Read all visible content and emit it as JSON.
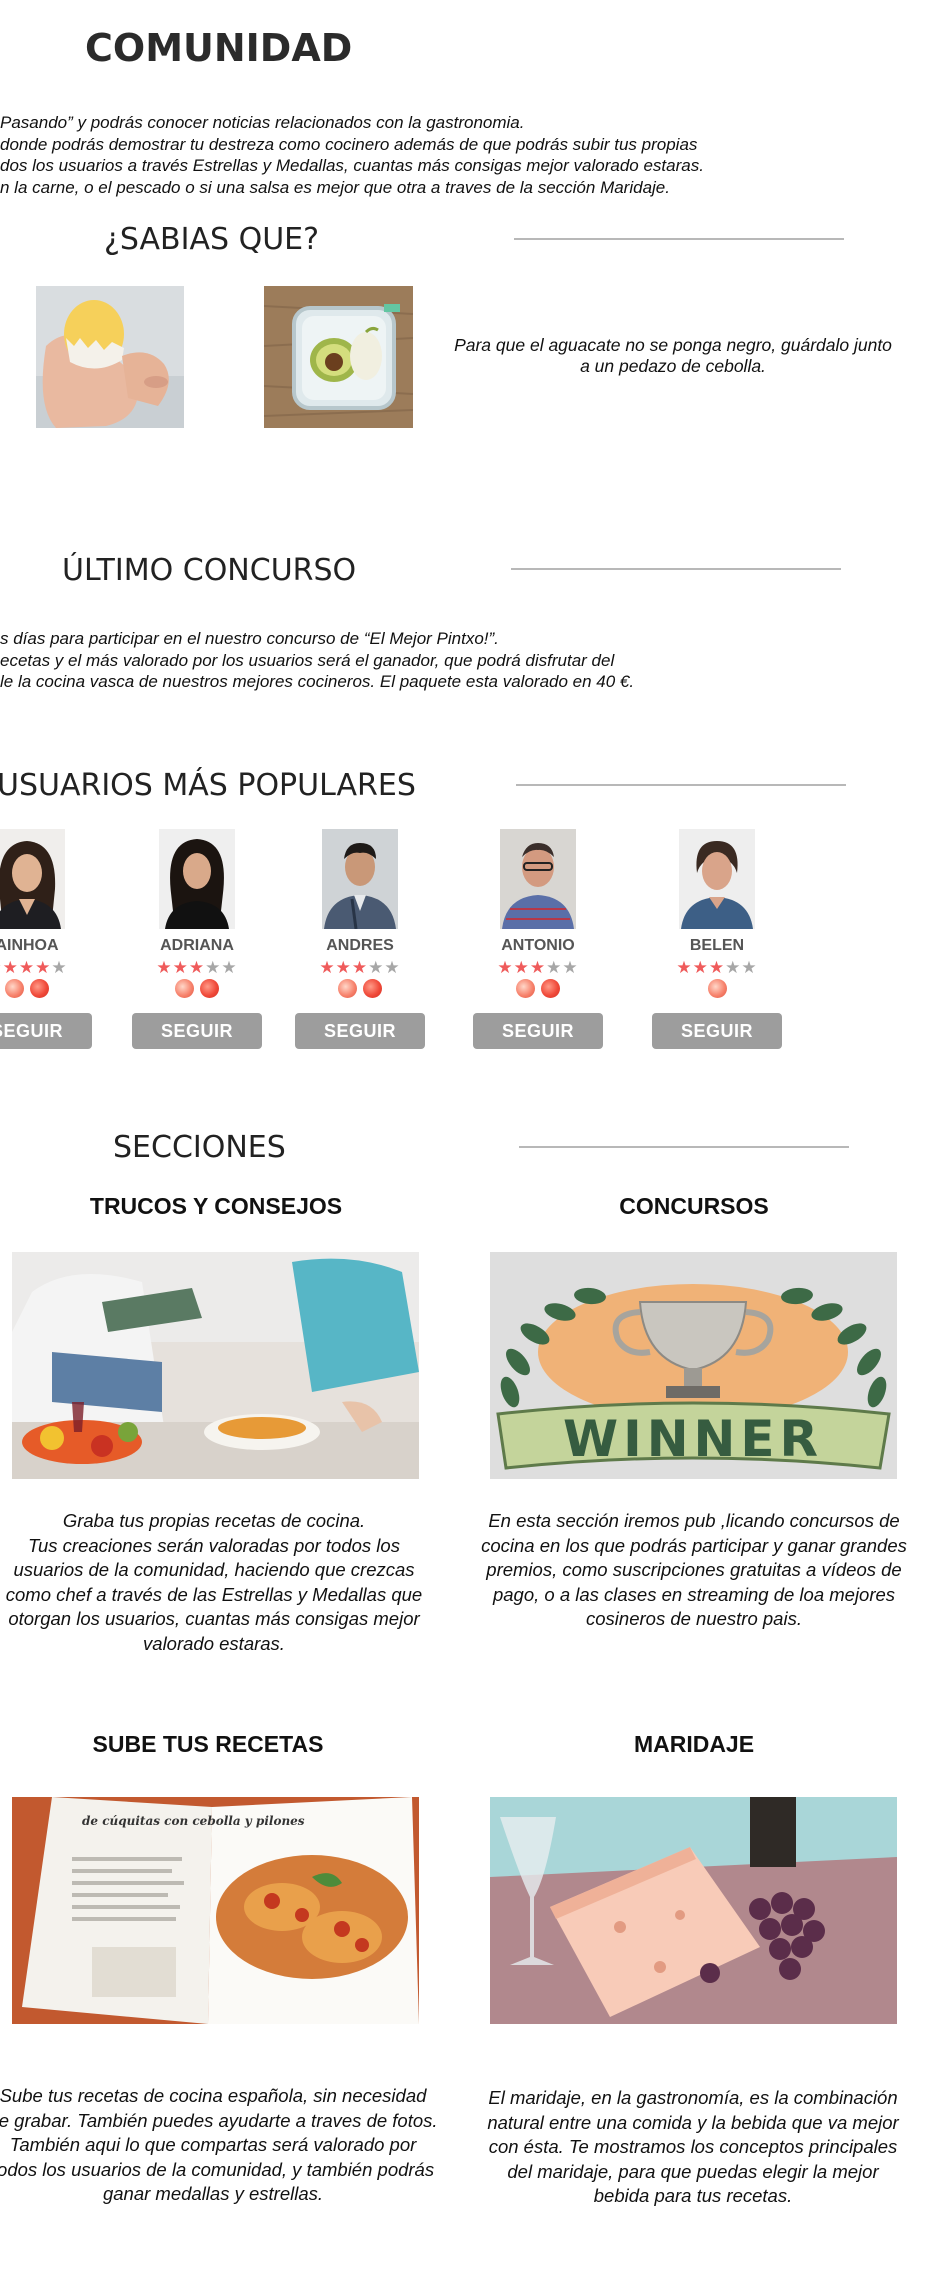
{
  "community": {
    "title": "COMUNIDAD",
    "lines": [
      "Pasando”  y podrás conocer noticias relacionados con la gastronomia.",
      "donde podrás demostrar tu destreza como cocinero además de que podrás subir tus propias",
      "dos los usuarios a través Estrellas y Medallas, cuantas más consigas mejor valorado estaras.",
      "n la carne, o el pescado o si una salsa es mejor que otra a traves de la sección Maridaje."
    ]
  },
  "tips": {
    "title": "¿SABIAS QUE?",
    "text": "Para que el aguacate no se ponga negro, guárdalo junto a un pedazo de cebolla."
  },
  "contest": {
    "title": "ÚLTIMO CONCURSO",
    "lines": [
      "s días para participar en el nuestro concurso de “El Mejor Pintxo!”.",
      "ecetas y el más valorado por los usuarios será el ganador, que podrá disfrutar del",
      "le la cocina vasca de nuestros mejores cocineros. El paquete esta valorado en 40 €."
    ]
  },
  "popular": {
    "title": "USUARIOS MÁS POPULARES",
    "users": [
      {
        "name": "AINHOA",
        "stars": 4,
        "medals": 2,
        "follow": "SEGUIR"
      },
      {
        "name": "ADRIANA",
        "stars": 3,
        "medals": 2,
        "follow": "SEGUIR"
      },
      {
        "name": "ANDRES",
        "stars": 3,
        "medals": 2,
        "follow": "SEGUIR"
      },
      {
        "name": "ANTONIO",
        "stars": 3,
        "medals": 2,
        "follow": "SEGUIR"
      },
      {
        "name": "BELEN",
        "stars": 3,
        "medals": 1,
        "follow": "SEGUIR"
      }
    ]
  },
  "sections": {
    "title": "SECCIONES",
    "tricks": {
      "title": "TRUCOS Y CONSEJOS",
      "text": "Graba tus propias recetas de cocina.\nTus creaciones serán valoradas por todos los usuarios de la comunidad, haciendo que crezcas como chef a través de las Estrellas y Medallas que otorgan los usuarios, cuantas más consigas mejor valorado estaras."
    },
    "contests": {
      "title": "CONCURSOS",
      "image_text": "WINNER",
      "text": "En esta sección iremos pub ,licando concursos de cocina en los que podrás participar y ganar grandes premios, como suscripciones gratuitas a vídeos de pago, o a las clases en streaming de loa mejores cosineros de nuestro pais."
    },
    "upload": {
      "title": "SUBE TUS RECETAS",
      "image_text": "de cúquitas con cebolla y pilones",
      "text": "Sube tus recetas de cocina española, sin necesidad de grabar. También puedes ayudarte a traves de fotos. También aqui lo que compartas será valorado por todos los usuarios de la comunidad, y también podrás ganar medallas y estrellas."
    },
    "pairing": {
      "title": "MARIDAJE",
      "text": "El maridaje, en la gastronomía, es la combinación natural entre una comida y la bebida que va mejor con ésta. Te mostramos los conceptos principales del maridaje, para que puedas elegir la mejor bebida para tus recetas."
    }
  },
  "colors": {
    "star_on": "#ef5b5b",
    "star_off": "#a7a7a7",
    "button": "#9d9d9d",
    "divider": "#b8b8b8"
  }
}
